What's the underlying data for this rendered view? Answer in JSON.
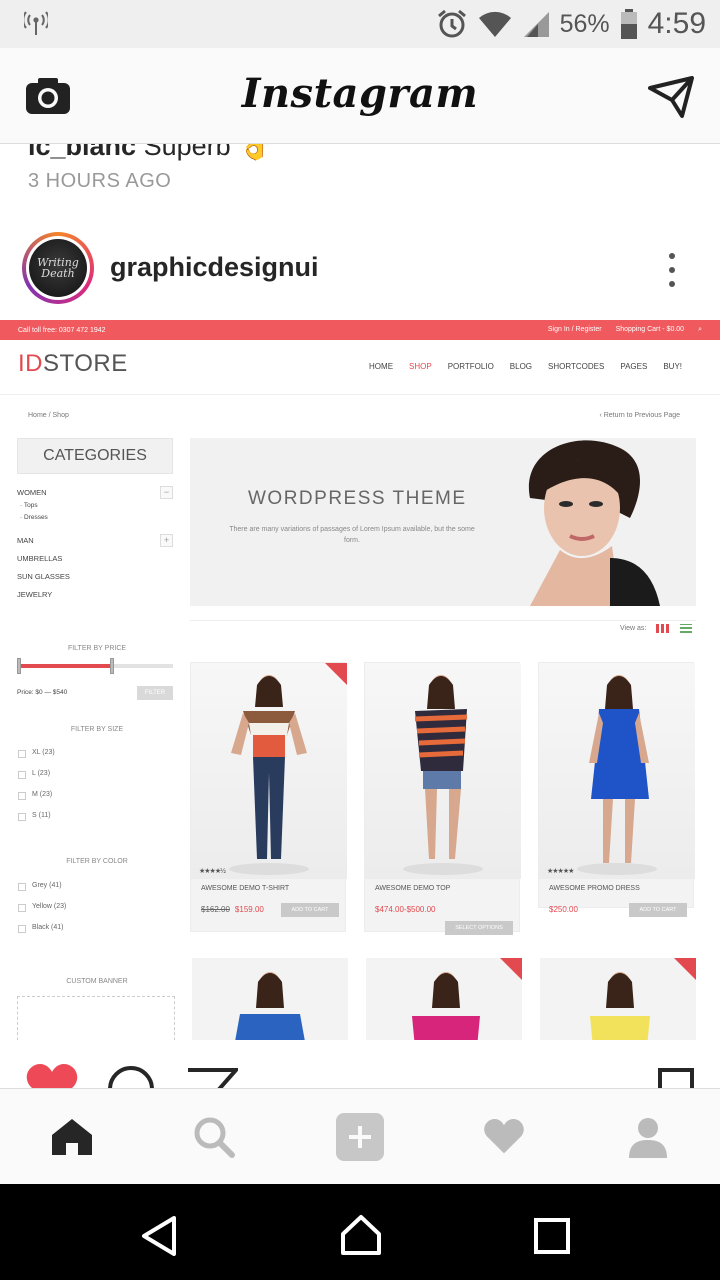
{
  "status_bar": {
    "battery": "56%",
    "time": "4:59"
  },
  "app_bar": {
    "title": "Instagram"
  },
  "previous_post": {
    "comment_user": "lc_blanc",
    "comment_text": "Superb",
    "emoji": "👌",
    "time_ago": "3 HOURS AGO"
  },
  "post": {
    "username": "graphicdesignui",
    "avatar_text": "Writing Death",
    "mockup": {
      "topbar_phone": "Call toll free: 0307 472 1942",
      "topbar_links": [
        "Sign In / Register",
        "Shopping Cart - $0.00"
      ],
      "brand_prefix": "ID",
      "brand_suffix": "STORE",
      "menu": [
        "HOME",
        "SHOP",
        "PORTFOLIO",
        "BLOG",
        "SHORTCODES",
        "PAGES",
        "BUY!"
      ],
      "breadcrumb": "Home / Shop",
      "return_link": "‹ Return to Previous Page",
      "categories_title": "CATEGORIES",
      "categories": [
        "WOMEN",
        "· Tops",
        "· Dresses",
        "MAN",
        "UMBRELLAS",
        "SUN GLASSES",
        "JEWELRY"
      ],
      "filter_price_title": "FILTER BY PRICE",
      "price_range": "Price: $0 — $540",
      "filter_button": "FILTER",
      "filter_size_title": "FILTER BY SIZE",
      "sizes": [
        "XL (23)",
        "L (23)",
        "M (23)",
        "S (11)"
      ],
      "filter_color_title": "FILTER BY COLOR",
      "colors": [
        "Grey (41)",
        "Yellow (23)",
        "Black (41)"
      ],
      "custom_banner_title": "CUSTOM BANNER",
      "hero_title": "WORDPRESS THEME",
      "hero_text": "There are many variations of passages of Lorem Ipsum available, but the some form.",
      "view_as": "View as:",
      "products": [
        {
          "name": "AWESOME DEMO T-SHIRT",
          "old_price": "$162.00",
          "price": "$159.00",
          "button": "ADD TO CART",
          "rating": "★★★★½"
        },
        {
          "name": "AWESOME DEMO TOP",
          "old_price": "",
          "price": "$474.00-$500.00",
          "button": "SELECT OPTIONS",
          "rating": ""
        },
        {
          "name": "AWESOME PROMO DRESS",
          "old_price": "",
          "price": "$250.00",
          "button": "ADD TO CART",
          "rating": "★★★★★"
        }
      ]
    }
  },
  "colors": {
    "accent": "#e24a4f",
    "like": "#ed4956"
  },
  "icons": {
    "status_left": "broadcast-icon",
    "status_right": [
      "alarm-icon",
      "wifi-icon",
      "signal-icon",
      "battery-icon"
    ],
    "app_bar": [
      "camera-icon",
      "direct-message-icon"
    ],
    "actions": [
      "heart-filled-icon",
      "comment-icon",
      "share-icon",
      "bookmark-icon"
    ],
    "bottom_nav": [
      "home-icon",
      "search-icon",
      "add-icon",
      "activity-heart-icon",
      "profile-icon"
    ],
    "system_nav": [
      "back-icon",
      "home-outline-icon",
      "recents-icon"
    ]
  }
}
